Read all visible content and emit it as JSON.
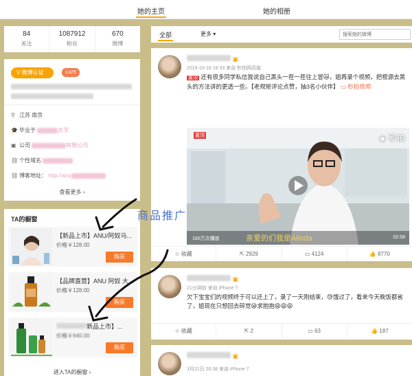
{
  "tabs": {
    "home": "她的主页",
    "album": "她的相册"
  },
  "stats": [
    {
      "num": "84",
      "label": "关注"
    },
    {
      "num": "1087912",
      "label": "粉丝"
    },
    {
      "num": "670",
      "label": "微博"
    }
  ],
  "profile": {
    "verify": "微博认证",
    "level": "Lv25",
    "location": "江苏 南京",
    "school_prefix": "毕业于",
    "school_suffix": "大学",
    "company_prefix": "公司",
    "company_suffix": "有限公司",
    "domain_label": "个性域名",
    "blog_label": "博客地址：",
    "blog_value": "http://anu",
    "view_more": "查看更多 ›"
  },
  "shop": {
    "title": "TA的橱窗",
    "items": [
      {
        "name": "【新品上市】ANU/阿奴马...",
        "price": "价格￥128.00",
        "buy": "购买"
      },
      {
        "name": "【品牌直营】ANU 阿奴 大...",
        "price": "价格￥128.00",
        "buy": "购买"
      },
      {
        "name": "新品上市】...",
        "price": "价格￥640.00",
        "buy": "购买"
      }
    ],
    "enter": "进入TA的橱窗 ›"
  },
  "annotation": "商品推广",
  "feed": {
    "filter_all": "全部",
    "filter_more": "更多 ▾",
    "search_placeholder": "搜索她的微博"
  },
  "posts": [
    {
      "meta": "2016-10-18 18:33 来自 秒拍网页版",
      "tag": "置顶",
      "text": "还有很多同学私信我说自己黑头一茬一茬往上冒😿，姐再录个视频，把根源去黑头的方法讲的更透一些。【老规矩评论点赞，抽3名小伙伴】",
      "link": "秒拍视频",
      "video": {
        "watermark": "秒拍",
        "views": "160万次播放",
        "caption": "亲爱的们我是Alinda",
        "duration": "02:58",
        "badge": "置顶"
      },
      "actions": {
        "fav": "收藏",
        "share": "2929",
        "comment": "4124",
        "like": "8770"
      }
    },
    {
      "meta": "21分钟前 来自 iPhone 7",
      "text": "欠下宝宝们的视频终于可以还上了，录了一天刚结束，😓饿过了，看来今天晚饭都省了，姐现在只想回去碎觉😪求抱抱😩😩😩",
      "actions": {
        "fav": "收藏",
        "share": "2",
        "comment": "63",
        "like": "187"
      }
    },
    {
      "meta": "3月21日 20:38 来自 iPhone 7"
    }
  ],
  "colors": {
    "accent": "#f7a400",
    "buy": "#f77a2a",
    "background": "#c9bd8a",
    "annotation": "#4a6fd0"
  }
}
